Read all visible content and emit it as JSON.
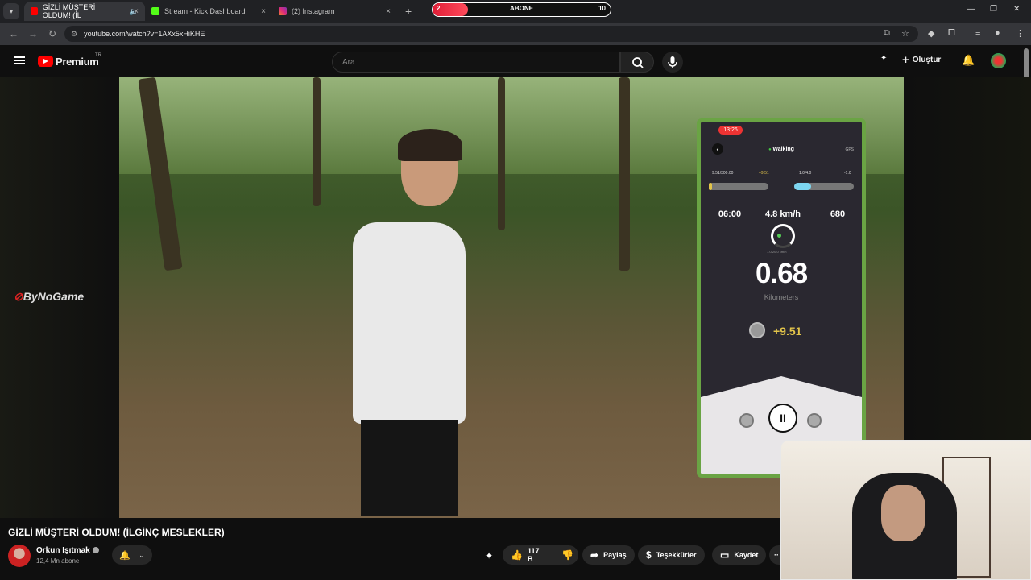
{
  "browser": {
    "tabs": [
      {
        "title": "GİZLİ MÜŞTERİ OLDUM! (İL",
        "active": true
      },
      {
        "title": "Stream - Kick Dashboard",
        "active": false
      },
      {
        "title": "(2) Instagram",
        "active": false
      }
    ],
    "url": "youtube.com/watch?v=1AXx5xHiKHE",
    "new_tab": "+",
    "close": "×"
  },
  "overlay_widget": {
    "label": "ABONE",
    "current": "2",
    "goal": "10",
    "progress": 0.2
  },
  "youtube_header": {
    "logo_text": "Premium",
    "region": "TR",
    "search_placeholder": "Ara",
    "create_label": "Oluştur"
  },
  "video": {
    "watermark_brand": "ByNoGame",
    "phone_app": {
      "time": "13:26",
      "mode": "Walking",
      "gps": "GPS",
      "stat_left": "9.51/300.00",
      "stat_left_gain": "+9.51",
      "stat_right": "1.0/4.0",
      "stat_right_delta": "-1.0",
      "duration": "06:00",
      "speed": "4.8 km/h",
      "speed_range": "1.0-20.0 km/h",
      "steps": "680",
      "distance": "0.68",
      "distance_unit": "Kilometers",
      "earned": "+9.51"
    }
  },
  "video_info": {
    "title": "GİZLİ MÜŞTERİ OLDUM! (İLGİNÇ MESLEKLER)",
    "channel_name": "Orkun Işıtmak",
    "subscribers": "12,4 Mn abone",
    "likes": "117 B",
    "share_label": "Paylaş",
    "thanks_label": "Teşekkürler",
    "save_label": "Kaydet"
  },
  "colors": {
    "accent": "#ff0000",
    "phone_frame": "#6aa444",
    "widget_fill": "#e01e37"
  }
}
